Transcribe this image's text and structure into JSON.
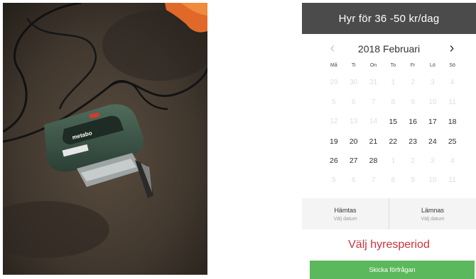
{
  "booking": {
    "price_header": "Hyr för 36 -50 kr/dag",
    "month_title": "2018 Februari",
    "prev_arrow": "‹",
    "next_arrow": "›",
    "weekdays": [
      "Må",
      "Ti",
      "On",
      "To",
      "Fr",
      "Lö",
      "Sö"
    ],
    "days": [
      {
        "label": "29",
        "enabled": false
      },
      {
        "label": "30",
        "enabled": false
      },
      {
        "label": "31",
        "enabled": false
      },
      {
        "label": "1",
        "enabled": false
      },
      {
        "label": "2",
        "enabled": false
      },
      {
        "label": "3",
        "enabled": false
      },
      {
        "label": "4",
        "enabled": false
      },
      {
        "label": "5",
        "enabled": false
      },
      {
        "label": "6",
        "enabled": false
      },
      {
        "label": "7",
        "enabled": false
      },
      {
        "label": "8",
        "enabled": false
      },
      {
        "label": "9",
        "enabled": false
      },
      {
        "label": "10",
        "enabled": false
      },
      {
        "label": "11",
        "enabled": false
      },
      {
        "label": "12",
        "enabled": false
      },
      {
        "label": "13",
        "enabled": false
      },
      {
        "label": "14",
        "enabled": false
      },
      {
        "label": "15",
        "enabled": true
      },
      {
        "label": "16",
        "enabled": true
      },
      {
        "label": "17",
        "enabled": true
      },
      {
        "label": "18",
        "enabled": true
      },
      {
        "label": "19",
        "enabled": true
      },
      {
        "label": "20",
        "enabled": true
      },
      {
        "label": "21",
        "enabled": true
      },
      {
        "label": "22",
        "enabled": true
      },
      {
        "label": "23",
        "enabled": true
      },
      {
        "label": "24",
        "enabled": true
      },
      {
        "label": "25",
        "enabled": true
      },
      {
        "label": "26",
        "enabled": true
      },
      {
        "label": "27",
        "enabled": true
      },
      {
        "label": "28",
        "enabled": true
      },
      {
        "label": "1",
        "enabled": false
      },
      {
        "label": "2",
        "enabled": false
      },
      {
        "label": "3",
        "enabled": false
      },
      {
        "label": "4",
        "enabled": false
      },
      {
        "label": "5",
        "enabled": false
      },
      {
        "label": "6",
        "enabled": false
      },
      {
        "label": "7",
        "enabled": false
      },
      {
        "label": "8",
        "enabled": false
      },
      {
        "label": "9",
        "enabled": false
      },
      {
        "label": "10",
        "enabled": false
      },
      {
        "label": "11",
        "enabled": false
      }
    ],
    "pickup_label": "Hämtas",
    "pickup_value": "Välj datum",
    "return_label": "Lämnas",
    "return_value": "Välj datum",
    "period_message": "Välj hyresperiod",
    "submit_label": "Skicka förfrågan"
  },
  "colors": {
    "header_bg": "#4b4b4b",
    "message": "#c9333b",
    "submit_bg": "#5cb85c"
  },
  "photo": {
    "subject": "jigsaw-on-concrete-floor",
    "product_text": "metabo"
  }
}
